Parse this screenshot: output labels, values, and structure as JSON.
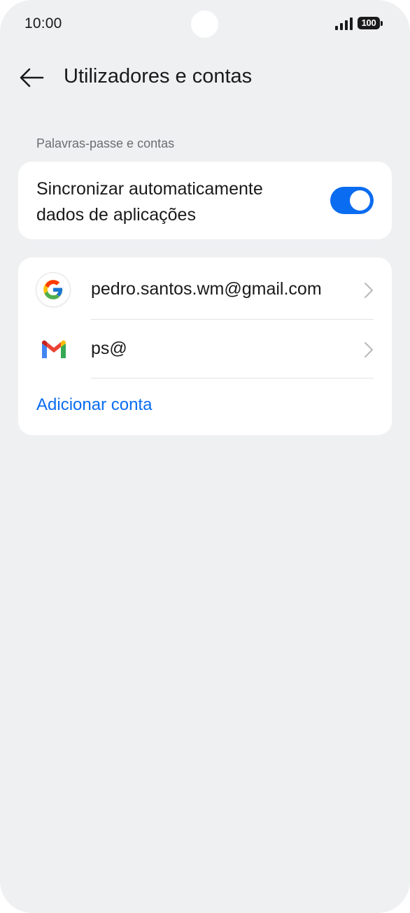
{
  "status_bar": {
    "time": "10:00",
    "battery_level": "100",
    "icons": [
      "signal-icon",
      "battery-icon"
    ]
  },
  "header": {
    "back_icon": "arrow-left-icon",
    "title": "Utilizadores e contas"
  },
  "section": {
    "label": "Palavras-passe e contas"
  },
  "sync": {
    "label": "Sincronizar automaticamente dados de aplicações",
    "enabled": true,
    "accent_color": "#0a6cf0"
  },
  "accounts": {
    "items": [
      {
        "icon": "google-icon",
        "name": "pedro.santos.wm@gmail.com"
      },
      {
        "icon": "gmail-icon",
        "name": "ps@"
      }
    ],
    "add_label": "Adicionar conta"
  },
  "colors": {
    "background": "#eff0f2",
    "card": "#ffffff",
    "accent": "#0a6cf0"
  }
}
